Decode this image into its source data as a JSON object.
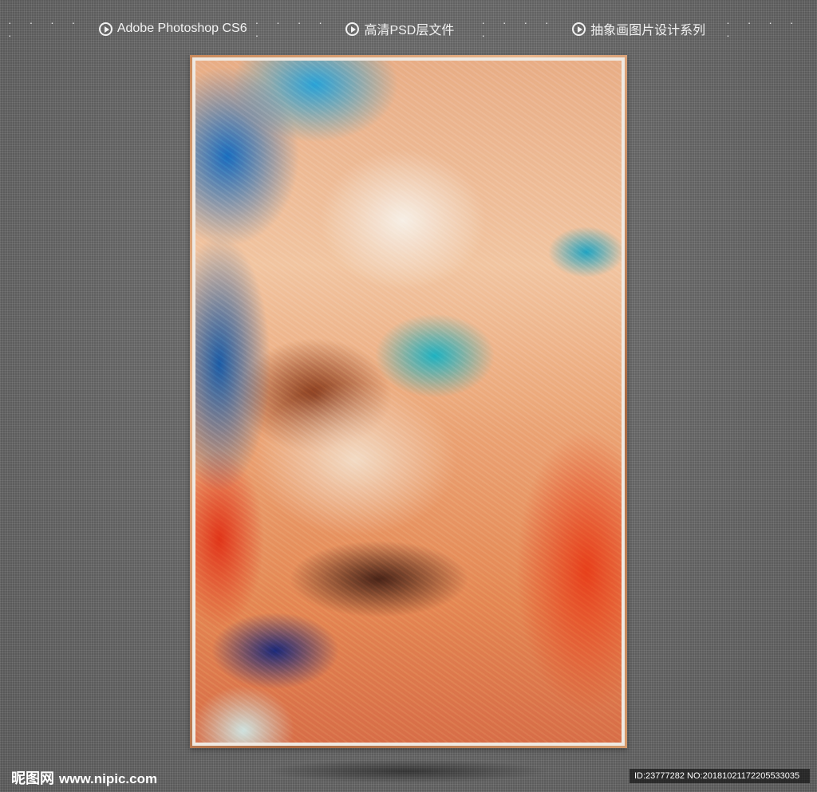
{
  "header": {
    "dots": "· · · · ·",
    "items": [
      {
        "label": "Adobe Photoshop CS6",
        "icon": "play-circle-icon"
      },
      {
        "label": "高清PSD层文件",
        "icon": "play-circle-icon"
      },
      {
        "label": "抽象画图片设计系列",
        "icon": "play-circle-icon"
      }
    ]
  },
  "artwork": {
    "frame_color": "#c98a5c",
    "mat_color": "#efe9e2",
    "palette": [
      "#1b6fc0",
      "#1fb3c2",
      "#f7efe6",
      "#eba577",
      "#e2361a",
      "#4a2418"
    ]
  },
  "footer": {
    "logo_cn": "昵图网",
    "logo_url": "www.nipic.com",
    "id_text": "ID:23777282 NO:20181021172205533035"
  }
}
